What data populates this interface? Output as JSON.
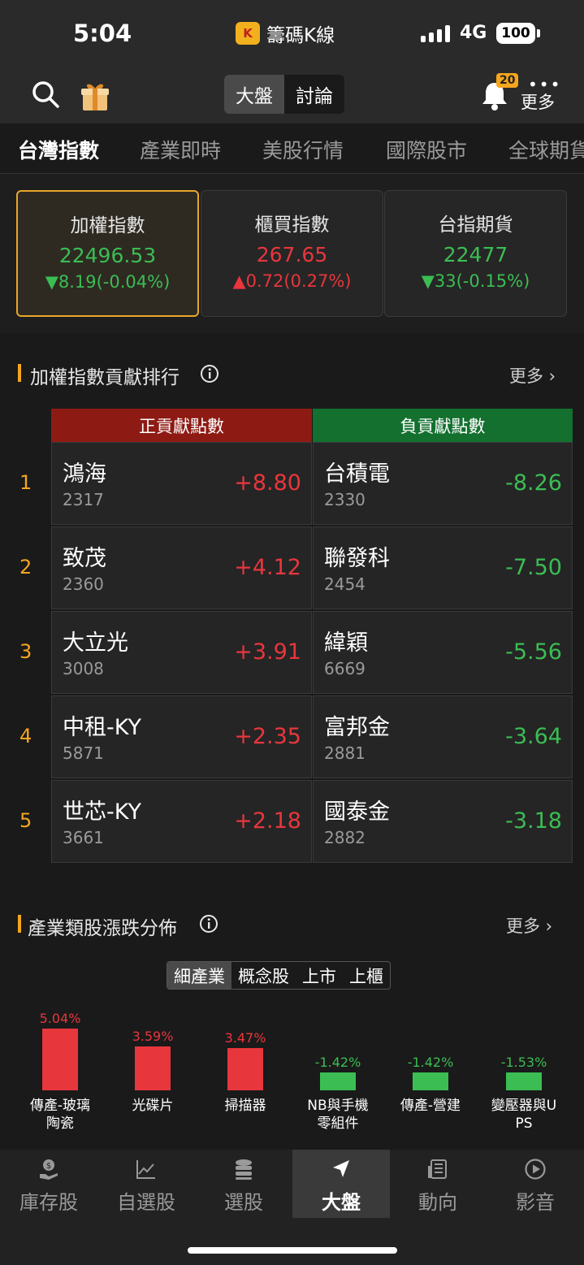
{
  "status": {
    "time": "5:04",
    "app_name": "籌碼K線",
    "app_logo": "K",
    "network": "4G",
    "battery": "100"
  },
  "header": {
    "seg": [
      "大盤",
      "討論"
    ],
    "bell_badge": "20",
    "more_dots": "•••",
    "more_label": "更多"
  },
  "tabs": [
    "台灣指數",
    "產業即時",
    "美股行情",
    "國際股市",
    "全球期貨"
  ],
  "cards": [
    {
      "name": "加權指數",
      "value": "22496.53",
      "change": "▼8.19(-0.04%)"
    },
    {
      "name": "櫃買指數",
      "value": "267.65",
      "change": "▲0.72(0.27%)"
    },
    {
      "name": "台指期貨",
      "value": "22477",
      "change": "▼33(-0.15%)"
    }
  ],
  "section1": {
    "title": "加權指數貢獻排行",
    "more": "更多 ›",
    "pos_header": "正貢獻點數",
    "neg_header": "負貢獻點數",
    "rows": [
      {
        "rank": "1",
        "pos_name": "鴻海",
        "pos_code": "2317",
        "pos_val": "+8.80",
        "neg_name": "台積電",
        "neg_code": "2330",
        "neg_val": "-8.26"
      },
      {
        "rank": "2",
        "pos_name": "致茂",
        "pos_code": "2360",
        "pos_val": "+4.12",
        "neg_name": "聯發科",
        "neg_code": "2454",
        "neg_val": "-7.50"
      },
      {
        "rank": "3",
        "pos_name": "大立光",
        "pos_code": "3008",
        "pos_val": "+3.91",
        "neg_name": "緯穎",
        "neg_code": "6669",
        "neg_val": "-5.56"
      },
      {
        "rank": "4",
        "pos_name": "中租-KY",
        "pos_code": "5871",
        "pos_val": "+2.35",
        "neg_name": "富邦金",
        "neg_code": "2881",
        "neg_val": "-3.64"
      },
      {
        "rank": "5",
        "pos_name": "世芯-KY",
        "pos_code": "3661",
        "pos_val": "+2.18",
        "neg_name": "國泰金",
        "neg_code": "2882",
        "neg_val": "-3.18"
      }
    ]
  },
  "section2": {
    "title": "產業類股漲跌分佈",
    "more": "更多 ›",
    "seg": [
      "細產業",
      "概念股",
      "上市",
      "上櫃"
    ],
    "bars": [
      {
        "pct": "5.04%",
        "value": 5.04,
        "label1": "傳產-玻璃",
        "label2": "陶瓷"
      },
      {
        "pct": "3.59%",
        "value": 3.59,
        "label1": "光碟片",
        "label2": ""
      },
      {
        "pct": "3.47%",
        "value": 3.47,
        "label1": "掃描器",
        "label2": ""
      },
      {
        "pct": "-1.42%",
        "value": -1.42,
        "label1": "NB與手機",
        "label2": "零組件"
      },
      {
        "pct": "-1.42%",
        "value": -1.42,
        "label1": "傳產-營建",
        "label2": ""
      },
      {
        "pct": "-1.53%",
        "value": -1.53,
        "label1": "變壓器與U",
        "label2": "PS"
      }
    ]
  },
  "nav": [
    "庫存股",
    "自選股",
    "選股",
    "大盤",
    "動向",
    "影音"
  ],
  "colors": {
    "up": "#e8363d",
    "down": "#3bbd53",
    "accent": "#f5a51e",
    "pos_header_bg": "#8e1a14",
    "neg_header_bg": "#13702f"
  }
}
